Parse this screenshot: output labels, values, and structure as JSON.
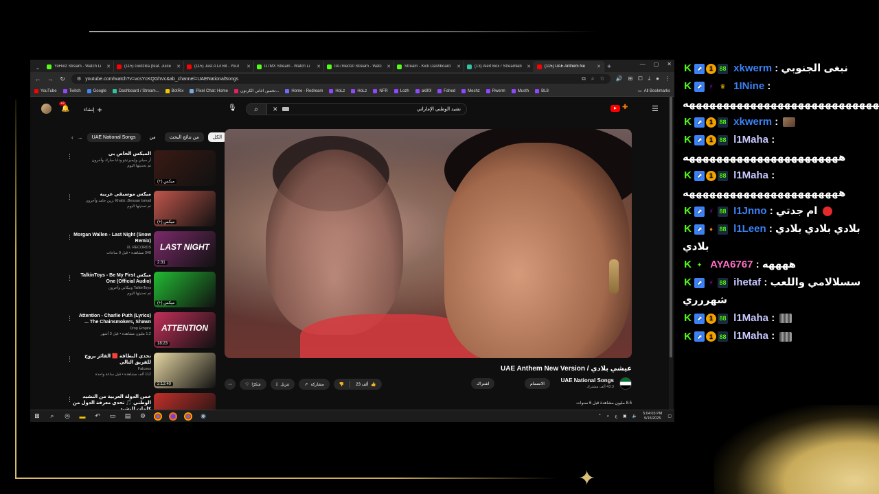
{
  "browser": {
    "tabs": [
      {
        "title": "YoHolz Stream - Watch Li",
        "color": "#53fc18"
      },
      {
        "title": "(115) Godzilla (feat. Juice",
        "color": "#ff0000"
      },
      {
        "title": "(115) Just A Lil Bit - YouT",
        "color": "#ff0000"
      },
      {
        "title": "D7MX Stream - Watch Li",
        "color": "#53fc18"
      },
      {
        "title": "IIA7med10 Stream - Watc",
        "color": "#53fc18"
      },
      {
        "title": "Stream - Kick Dashboard",
        "color": "#53fc18"
      },
      {
        "title": "(13) Alert Box / Streamlab",
        "color": "#31c3a2"
      },
      {
        "title": "(115) UAE Anthem Ne",
        "color": "#ff0000"
      }
    ],
    "url": "youtube.com/watch?v=vcsYcKQGhVc&ab_channel=UAENationalSongs",
    "bookmarks": [
      {
        "label": "YouTube",
        "color": "#ff0000"
      },
      {
        "label": "Twitch",
        "color": "#9146ff"
      },
      {
        "label": "Google",
        "color": "#4285f4"
      },
      {
        "label": "Dashboard / Stream...",
        "color": "#31c3a2"
      },
      {
        "label": "BotRix",
        "color": "#f5c400"
      },
      {
        "label": "Pixel Chat: Home",
        "color": "#7ad"
      },
      {
        "label": "تخمين اغاني الكرتون...",
        "color": "#e91e63"
      },
      {
        "label": "Home - Redream",
        "color": "#6c6cff"
      },
      {
        "label": "HoLz",
        "color": "#9146ff"
      },
      {
        "label": "HoLz",
        "color": "#9146ff"
      },
      {
        "label": "NFR",
        "color": "#9146ff"
      },
      {
        "label": "Lozh",
        "color": "#9146ff"
      },
      {
        "label": "ak90l",
        "color": "#9146ff"
      },
      {
        "label": "Fahed",
        "color": "#9146ff"
      },
      {
        "label": "Meshz",
        "color": "#9146ff"
      },
      {
        "label": "Rwerm",
        "color": "#9146ff"
      },
      {
        "label": "Musth",
        "color": "#9146ff"
      },
      {
        "label": "BL8",
        "color": "#9146ff"
      }
    ],
    "all_bookmarks": "All Bookmarks"
  },
  "youtube": {
    "create_label": "إنشاء",
    "notif_count": "+9",
    "search_query": "نشيد الوطني الإماراتي",
    "chips": {
      "all": "الكل",
      "from_search": "من نتائج البحث",
      "from": "من",
      "channel": "UAE National Songs"
    },
    "recommendations": [
      {
        "title": "الميكس الخاص بي",
        "channel": "أر سيلي وإيميرنيتو ودابا مبارك وآخرون",
        "sub": "تم تحديثها اليوم",
        "duration": "(+) ميكس",
        "thumb": "#3a1a14",
        "thumb_text": ""
      },
      {
        "title": "ميكس موسيقي عربية",
        "channel": "Khaliz ،Bessan Ismail ،زين حامد وآخرون",
        "sub": "تم تحديثها اليوم",
        "duration": "(+) ميكس",
        "thumb": "#c0574c",
        "thumb_text": ""
      },
      {
        "title": "Morgan Wallen - Last Night (Snow Remix)",
        "channel": "XL RECORDS",
        "sub": "340 مشاهدة • قبل 9 ساعات",
        "duration": "2:31",
        "thumb": "#7a2a6a",
        "thumb_text": "LAST NIGHT"
      },
      {
        "title": "ميكس TalkinToys - Be My First One (Official Audio)",
        "channel": "TalkinToys ونيكاني وآخرون",
        "sub": "تم تحديثها اليوم",
        "duration": "(+) ميكس",
        "thumb": "#22bb33",
        "thumb_text": ""
      },
      {
        "title": "Attention - Charlie Puth (Lyrics) The Chainsmokers, Shawn ...",
        "channel": "Drop Empire",
        "sub": "1.2 مليون مشاهدة • قبل 3 أشهر",
        "duration": "18:23",
        "thumb": "#c2305a",
        "thumb_text": "ATTENTION"
      },
      {
        "title": "تحدي البطاقة 🟥 الفائز يروح للفريق التالي",
        "channel": "Falcons",
        "sub": "112 ألف مشاهدة • قبل ساعة واحدة",
        "duration": "2:12:40",
        "thumb": "#e6d7a3",
        "thumb_text": ""
      },
      {
        "title": "خمن الدولة العربية من النشيد الوطني 🎵 تحدي معرفة الدول من كلمات النشيد",
        "channel": "",
        "sub": "",
        "duration": "",
        "thumb": "#c0302a",
        "thumb_text": ""
      }
    ],
    "video_title": "عيشي بلادي / UAE Anthem New Version",
    "channel_name": "UAE National Songs",
    "channel_subs": "43.3 ألف مشترك",
    "join_label": "الانضمام",
    "subscribe_label": "اشتراك",
    "like_count": "23 ألف",
    "share_label": "مشاركة",
    "download_label": "تنزيل",
    "thanks_label": "شكرًا",
    "views": "8.5 مليون مشاهدة  قبل 6 سنوات"
  },
  "taskbar": {
    "time": "5:04:03 PM",
    "date": "9/15/2025",
    "lang": "ع"
  },
  "chat": [
    {
      "badges": [
        "k",
        "up",
        "one",
        "gem"
      ],
      "user": "xkwerm",
      "color": "#3b82f6",
      "text": "نبغى الجنوبي",
      "emote": ""
    },
    {
      "badges": [
        "k",
        "up",
        "bolt",
        "crown"
      ],
      "user": "1INine",
      "color": "#3b82f6",
      "text": "ههههههههههههههههههههههههههههههههه",
      "emote": ""
    },
    {
      "badges": [
        "k",
        "up",
        "one",
        "gem"
      ],
      "user": "xkwerm",
      "color": "#3b82f6",
      "text": "",
      "emote": "cat"
    },
    {
      "badges": [
        "k",
        "up",
        "one",
        "gem"
      ],
      "user": "l1Maha",
      "color": "#c8c8ff",
      "text": "هههههههههههههههههههههههه",
      "emote": ""
    },
    {
      "badges": [
        "k",
        "up",
        "one",
        "gem"
      ],
      "user": "l1Maha",
      "color": "#c8c8ff",
      "text": "هههههههههههههههههههههههه",
      "emote": ""
    },
    {
      "badges": [
        "k",
        "up",
        "bolt",
        "gem"
      ],
      "user": "I1Jnno",
      "color": "#3b82f6",
      "text": "ام جدتي",
      "emote": "angry"
    },
    {
      "badges": [
        "k",
        "up",
        "fire",
        "gem"
      ],
      "user": "l1Leen",
      "color": "#3b82f6",
      "text": "بلادي بلادي بلادي بلادي",
      "emote": ""
    },
    {
      "badges": [
        "k",
        "diamond"
      ],
      "user": "AYA6767",
      "color": "#ff6ec7",
      "text": "ههههه",
      "emote": ""
    },
    {
      "badges": [
        "k",
        "up",
        "bolt",
        "gem"
      ],
      "user": "ihetaf",
      "color": "#c8c8ff",
      "text": "سسلالامي واللعب شهررري",
      "emote": ""
    },
    {
      "badges": [
        "k",
        "up",
        "one",
        "gem"
      ],
      "user": "l1Maha",
      "color": "#c8c8ff",
      "text": "",
      "emote": "grid"
    },
    {
      "badges": [
        "k",
        "up",
        "one",
        "gem"
      ],
      "user": "l1Maha",
      "color": "#c8c8ff",
      "text": "",
      "emote": "grid"
    }
  ]
}
